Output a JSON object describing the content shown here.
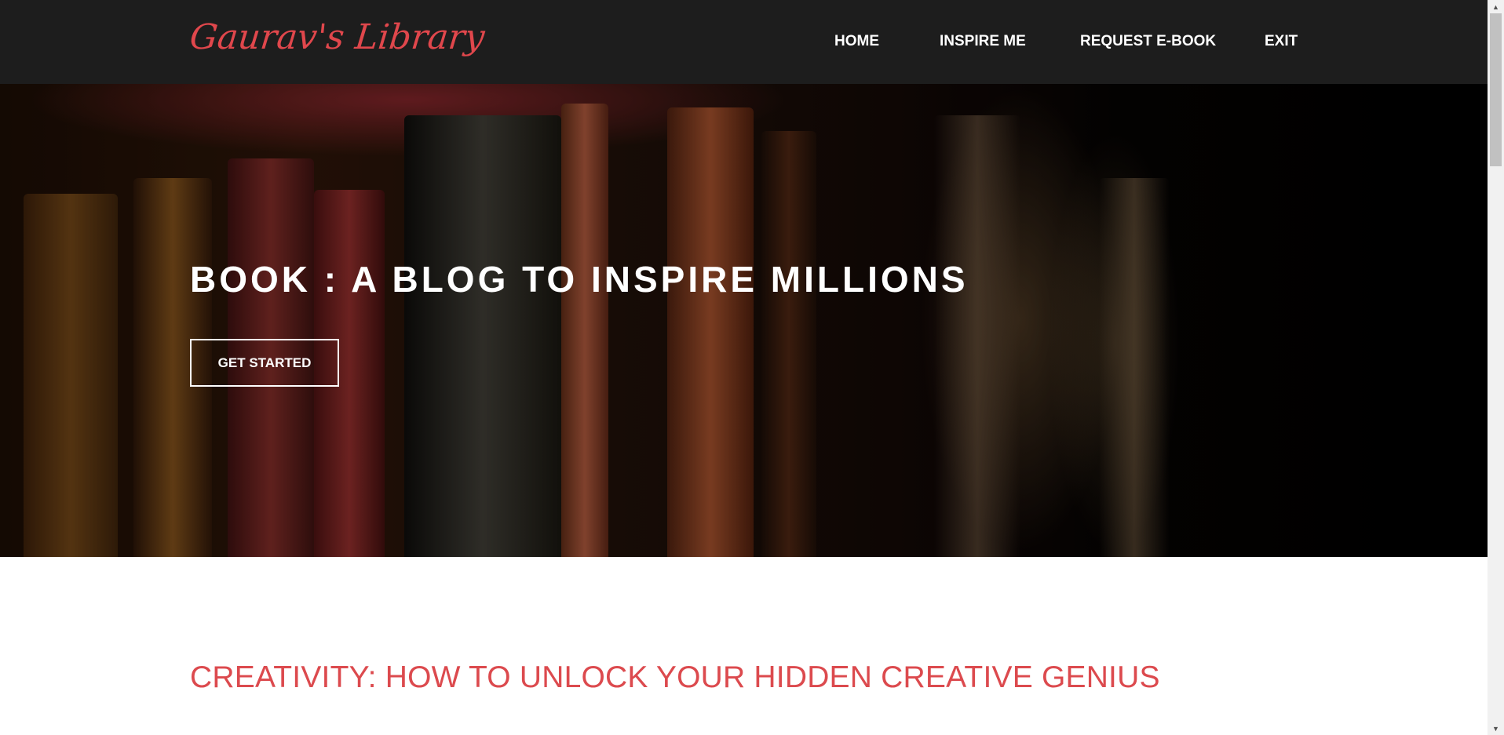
{
  "site": {
    "logo_text": "Gaurav's Library"
  },
  "nav": {
    "items": [
      {
        "label": "HOME"
      },
      {
        "label": "INSPIRE ME"
      },
      {
        "label": "REQUEST E-BOOK"
      },
      {
        "label": "EXIT"
      }
    ]
  },
  "hero": {
    "title_strong": "BOOK :",
    "title_rest": " A BLOG TO INSPIRE MILLIONS",
    "cta_label": "GET STARTED",
    "background_image": "old-books-on-shelf"
  },
  "article": {
    "title": "CREATIVITY: HOW TO UNLOCK YOUR HIDDEN CREATIVE GENIUS"
  },
  "colors": {
    "navbar_bg": "#1d1d1d",
    "accent": "#e0474c",
    "heading_red": "#dc4a4e",
    "text_light": "#ffffff"
  }
}
